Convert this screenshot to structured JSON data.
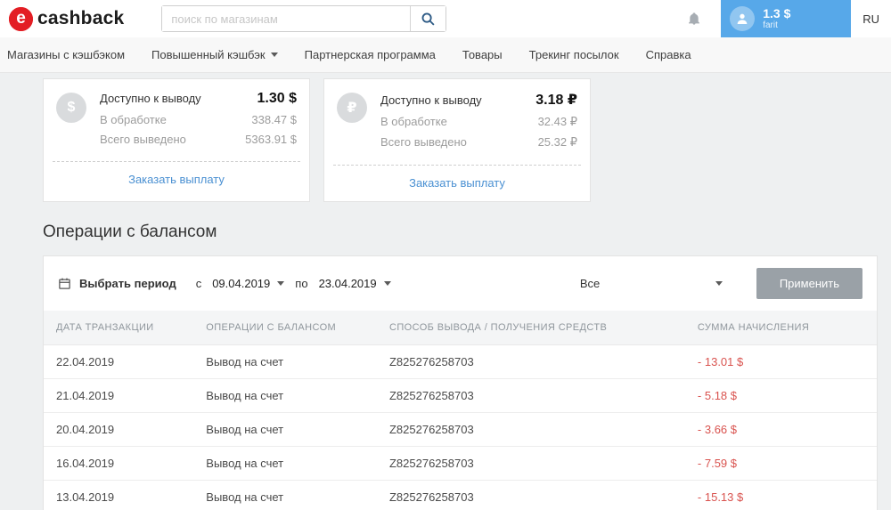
{
  "colors": {
    "accent_blue": "#57a8e9",
    "link_blue": "#4a90d2",
    "logo_red": "#e31e24",
    "negative_red": "#d9534f",
    "apply_gray": "#9aa1a7"
  },
  "icons": {
    "logo": "e-circle-icon",
    "search": "magnifier-icon",
    "bell": "bell-icon",
    "avatar": "person-icon",
    "calendar": "calendar-icon",
    "caret": "caret-down-icon"
  },
  "header": {
    "logo_letter": "e",
    "logo_text": "cashback",
    "search_placeholder": "поиск по магазинам",
    "user": {
      "balance": "1.3 $",
      "name": "farit"
    },
    "lang": "RU"
  },
  "nav": {
    "items": [
      {
        "label": "Магазины с кэшбэком"
      },
      {
        "label": "Повышенный кэшбэк"
      },
      {
        "label": "Партнерская программа"
      },
      {
        "label": "Товары"
      },
      {
        "label": "Трекинг посылок"
      },
      {
        "label": "Справка"
      }
    ]
  },
  "balance_cards": [
    {
      "symbol": "$",
      "available_label": "Доступно к выводу",
      "available_value": "1.30 $",
      "processing_label": "В обработке",
      "processing_value": "338.47 $",
      "total_label": "Всего выведено",
      "total_value": "5363.91 $",
      "action_label": "Заказать выплату"
    },
    {
      "symbol": "₽",
      "available_label": "Доступно к выводу",
      "available_value": "3.18 ₽",
      "processing_label": "В обработке",
      "processing_value": "32.43 ₽",
      "total_label": "Всего выведено",
      "total_value": "25.32 ₽",
      "action_label": "Заказать выплату"
    }
  ],
  "section_title": "Операции с балансом",
  "filter": {
    "period_label": "Выбрать период",
    "from_label": "с",
    "from_value": "09.04.2019",
    "to_label": "по",
    "to_value": "23.04.2019",
    "type_value": "Все",
    "apply_label": "Применить"
  },
  "table": {
    "headers": [
      "ДАТА ТРАНЗАКЦИИ",
      "ОПЕРАЦИИ С БАЛАНСОМ",
      "СПОСОБ ВЫВОДА / ПОЛУЧЕНИЯ СРЕДСТВ",
      "СУММА НАЧИСЛЕНИЯ"
    ],
    "rows": [
      {
        "date": "22.04.2019",
        "operation": "Вывод на счет",
        "method": "Z825276258703",
        "amount": "- 13.01 $"
      },
      {
        "date": "21.04.2019",
        "operation": "Вывод на счет",
        "method": "Z825276258703",
        "amount": "- 5.18 $"
      },
      {
        "date": "20.04.2019",
        "operation": "Вывод на счет",
        "method": "Z825276258703",
        "amount": "- 3.66 $"
      },
      {
        "date": "16.04.2019",
        "operation": "Вывод на счет",
        "method": "Z825276258703",
        "amount": "- 7.59 $"
      },
      {
        "date": "13.04.2019",
        "operation": "Вывод на счет",
        "method": "Z825276258703",
        "amount": "- 15.13 $"
      }
    ]
  }
}
